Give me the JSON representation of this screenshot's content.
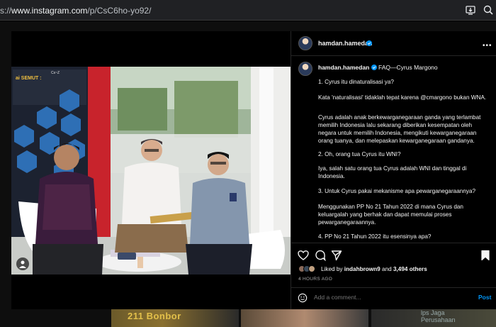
{
  "browser": {
    "url_prefix": "s://",
    "url_host": "www.instagram.com",
    "url_path": "/p/CsC6ho-yo92/"
  },
  "post": {
    "author": "hamdan.hamedan",
    "caption_title": "FAQ—Cyrus Margono",
    "caption_paragraphs": [
      "1. Cyrus itu dinaturalisasi ya?",
      "Kata 'naturalisasi' tidaklah tepat karena @cmargono bukan WNA.",
      "Cyrus adalah anak berkewarganegaraan ganda yang terlambat memilih Indonesia lalu sekarang diberikan kesempatan oleh negara untuk memilih Indonesia, mengikuti kewarganegaraan orang tuanya, dan melepaskan kewarganegaraan gandanya.",
      "2. Oh, orang tua Cyrus itu WNI?",
      "Iya, salah satu orang tua Cyrus adalah WNI dan tinggal di Indonesia.",
      "3. Untuk Cyrus pakai mekanisme apa pewarganegaraannya?",
      "Menggunakan PP No 21 Tahun 2022 di mana Cyrus dan keluargalah yang berhak dan dapat memulai proses pewarganegaraannya.",
      "4. PP No 21 Tahun 2022 itu esensinya apa?"
    ],
    "likes_prefix": "Liked by",
    "liked_by_user": "indahbrown9",
    "likes_conj": "and",
    "likes_others": "3,494 others",
    "time_ago": "4 HOURS AGO",
    "comment_placeholder": "Add a comment...",
    "post_label": "Post"
  },
  "photo": {
    "poster_heading": "ai SEMUT :",
    "poster_subheading": "Cs~Z"
  },
  "peek": {
    "text_left": "211 Bonbor",
    "text_right": "lps Jaga\nPerusahaan"
  },
  "icons": {
    "verified": "verified-badge-icon",
    "more": "more-options-icon",
    "like": "heart-icon",
    "comment": "comment-bubble-icon",
    "share": "paper-plane-icon",
    "save": "bookmark-icon",
    "emoji": "smiley-icon",
    "close": "close-icon",
    "install": "install-app-icon",
    "zoom": "zoom-icon"
  },
  "colors": {
    "accent": "#0095f6",
    "background": "#000000",
    "text": "#f5f5f5",
    "muted": "#a8a8a8",
    "divider": "#262626"
  }
}
